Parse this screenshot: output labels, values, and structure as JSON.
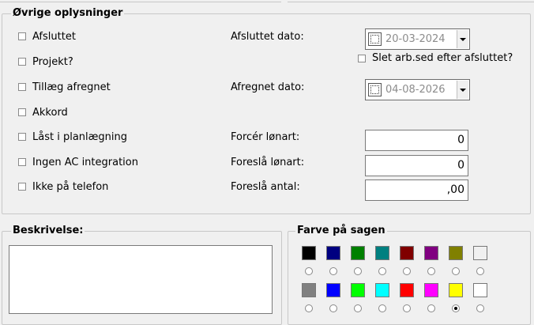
{
  "details": {
    "title": "Øvrige oplysninger",
    "checkboxes": [
      {
        "label": "Afsluttet",
        "checked": false
      },
      {
        "label": "Projekt?",
        "checked": false
      },
      {
        "label": "Tillæg afregnet",
        "checked": false
      },
      {
        "label": "Akkord",
        "checked": false
      },
      {
        "label": "Låst i planlægning",
        "checked": false
      },
      {
        "label": "Ingen AC integration",
        "checked": false
      },
      {
        "label": "Ikke på telefon",
        "checked": false
      }
    ],
    "afsluttet_dato": {
      "label": "Afsluttet dato:",
      "value": "20-03-2024",
      "checked": false
    },
    "slet_arb": {
      "label": "Slet arb.sed efter afsluttet?",
      "checked": false
    },
    "afregnet_dato": {
      "label": "Afregnet dato:",
      "value": "04-08-2026",
      "checked": false
    },
    "forcer_lonart": {
      "label": "Forcér lønart:",
      "value": "0"
    },
    "foresla_lonart": {
      "label": "Foreslå lønart:",
      "value": "0"
    },
    "foresla_antal": {
      "label": "Foreslå antal:",
      "value": ",00"
    }
  },
  "description": {
    "title": "Beskrivelse:",
    "value": ""
  },
  "color": {
    "title": "Farve på sagen",
    "swatches": [
      "#000000",
      "#000080",
      "#008000",
      "#008080",
      "#800000",
      "#800080",
      "#808000",
      "#f0f0f0",
      "#808080",
      "#0000ff",
      "#00ff00",
      "#00ffff",
      "#ff0000",
      "#ff00ff",
      "#ffff00",
      "#ffffff"
    ],
    "selected_index": 14
  }
}
